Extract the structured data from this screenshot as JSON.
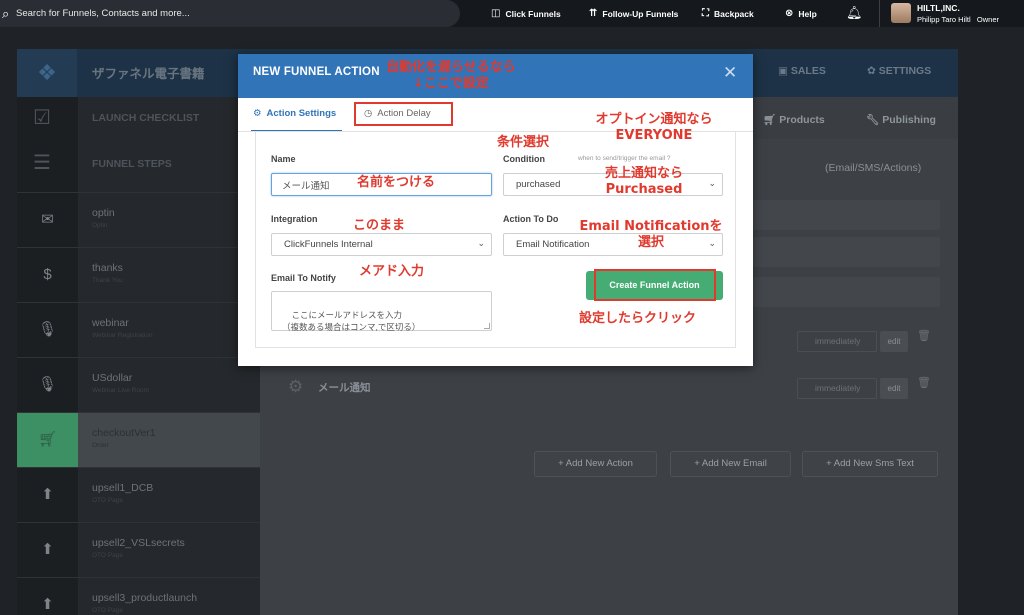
{
  "topbar": {
    "search_placeholder": "Search for Funnels, Contacts and more...",
    "nav": [
      {
        "label": "Click Funnels",
        "icon": "clickfunnels-icon",
        "glyph": "◫"
      },
      {
        "label": "Follow-Up Funnels",
        "icon": "chevrons-up-icon",
        "glyph": "⇈"
      },
      {
        "label": "Backpack",
        "icon": "backpack-icon",
        "glyph": "⛶"
      },
      {
        "label": "Help",
        "icon": "help-icon",
        "glyph": "⊗"
      }
    ],
    "user": {
      "company": "HILTL,INC.",
      "name": "Philipp Taro Hiltl",
      "role": "Owner"
    }
  },
  "funnel": {
    "title": "ザファネル電子書籍",
    "header_tabs": [
      "SALES",
      "SETTINGS"
    ],
    "sub_tabs": [
      "Products",
      "Publishing"
    ],
    "email_header": "(Email/SMS/Actions)"
  },
  "sidebar": {
    "launch_checklist": "LAUNCH CHECKLIST",
    "funnel_steps": "FUNNEL STEPS",
    "steps": [
      {
        "name": "optin",
        "sub": "Optin"
      },
      {
        "name": "thanks",
        "sub": "Thank You"
      },
      {
        "name": "webinar",
        "sub": "Webinar Registration"
      },
      {
        "name": "USdollar",
        "sub": "Webinar Live Room"
      },
      {
        "name": "checkoutVer1",
        "sub": "Order"
      },
      {
        "name": "upsell1_DCB",
        "sub": "OTO Page"
      },
      {
        "name": "upsell2_VSLsecrets",
        "sub": "OTO Page"
      },
      {
        "name": "upsell3_productlaunch",
        "sub": "OTO Page"
      }
    ]
  },
  "actions": {
    "rows": [
      {
        "name": "",
        "timing": "immediately",
        "edit": "edit"
      },
      {
        "name": "メール通知",
        "timing": "immediately",
        "edit": "edit"
      }
    ],
    "add_buttons": [
      "Add New Action",
      "Add New Email",
      "Add New Sms Text"
    ]
  },
  "modal": {
    "title": "NEW FUNNEL ACTION",
    "tabs": {
      "settings": "Action Settings",
      "delay": "Action Delay"
    },
    "name_label": "Name",
    "name_value": "メール通知",
    "condition_label": "Condition",
    "condition_hint": "when to send/trigger the email",
    "condition_value": "purchased",
    "integration_label": "Integration",
    "integration_value": "ClickFunnels Internal",
    "action_label": "Action To Do",
    "action_value": "Email Notification",
    "email_label": "Email To Notify",
    "email_placeholder": "ここにメールアドレスを入力\n（複数ある場合はコンマ,で区切る）",
    "create_button": "Create Funnel Action"
  },
  "annotations": {
    "delay": "自動化を遅らせるなら\n↓ここで設定",
    "condition": "条件選択",
    "optin": "オプトイン通知なら\nEVERYONE",
    "sales": "売上通知なら\nPurchased",
    "name": "名前をつける",
    "integration": "このまま",
    "action": "Email Notificationを\n選択",
    "email": "メアド入力",
    "click": "設定したらクリック"
  },
  "colors": {
    "modal_header": "#3174b8",
    "accent_green": "#45ad73",
    "annotation_red": "#e03a2f"
  }
}
